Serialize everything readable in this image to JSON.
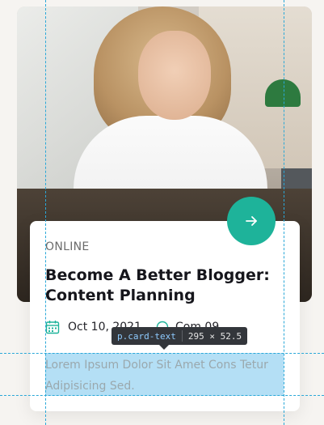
{
  "card": {
    "category": "ONLINE",
    "title": "Become A Better Blogger: Content Planning",
    "date": "Oct 10, 2021",
    "comments": "Com 09",
    "text": "Lorem Ipsum Dolor Sit Amet Cons Tetur Adipisicing Sed."
  },
  "devtools": {
    "selector": "p.card-text",
    "dimensions": "295 × 52.5"
  },
  "colors": {
    "accent": "#1eb39a",
    "text_muted": "#9aa8ad",
    "guide": "#2aa8d8",
    "highlight": "#76c4ec"
  },
  "icons": {
    "arrow": "arrow-right-icon",
    "calendar": "calendar-icon",
    "comment": "comment-icon"
  }
}
